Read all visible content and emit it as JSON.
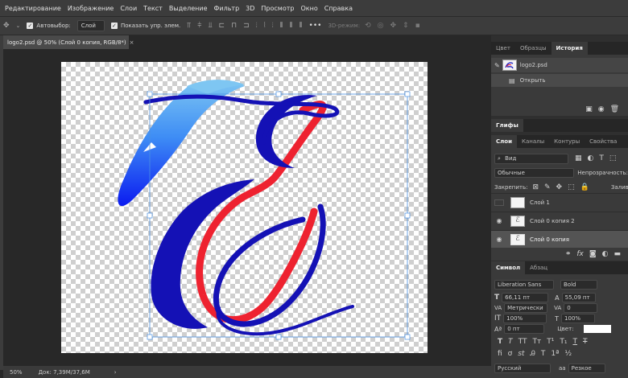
{
  "menu": [
    "Редактирование",
    "Изображение",
    "Слои",
    "Текст",
    "Выделение",
    "Фильтр",
    "3D",
    "Просмотр",
    "Окно",
    "Справка"
  ],
  "options": {
    "autoselect_label": "Автовыбор:",
    "autoselect_value": "Слой",
    "show_controls_label": "Показать упр. элем.",
    "mode_3d": "3D-режим:",
    "more": "•••"
  },
  "document": {
    "tab_title": "logo2.psd @ 50% (Слой 0 копия, RGB/8*)",
    "close": "×",
    "zoom": "50%",
    "doc_info": "Док: 7,39M/37,6M",
    "status_arrow": "›"
  },
  "history_panel": {
    "tabs": [
      "Цвет",
      "Образцы",
      "История"
    ],
    "active_tab": "История",
    "snapshot": "logo2.psd",
    "step": "Открыть"
  },
  "glyphs_panel": {
    "tab": "Глифы"
  },
  "layers_panel": {
    "tabs": [
      "Слои",
      "Каналы",
      "Контуры",
      "Свойства"
    ],
    "active_tab": "Слои",
    "filter": "Вид",
    "blend_mode": "Обычные",
    "opacity_label": "Непрозрачность:",
    "lock_label": "Закрепить:",
    "fill_label": "Заливка:",
    "layers": [
      {
        "name": "Слой 1",
        "visible": false
      },
      {
        "name": "Слой 0 копия 2",
        "visible": true
      },
      {
        "name": "Слой 0 копия",
        "visible": true,
        "selected": true
      }
    ],
    "footer_icons": [
      "link-icon",
      "fx-icon",
      "mask-icon",
      "adjustment-icon",
      "group-icon"
    ]
  },
  "character_panel": {
    "tabs": [
      "Символ",
      "Абзац"
    ],
    "active_tab": "Символ",
    "font_family": "Liberation Sans",
    "font_style": "Bold",
    "font_size": "66,11 пт",
    "leading": "55,09 пт",
    "kerning": "Метрически",
    "tracking": "0",
    "vscale": "100%",
    "hscale": "100%",
    "baseline": "0 пт",
    "color_label": "Цвет:",
    "language": "Русский",
    "aa_icon_text": "aa",
    "antialias": "Резкое"
  },
  "colors": {
    "feather_top": "#7ec6f2",
    "feather_bottom": "#0b1bf0",
    "letter_blue": "#1411b5",
    "letter_red": "#ee2230",
    "accent_selection": "#4a90e2"
  }
}
